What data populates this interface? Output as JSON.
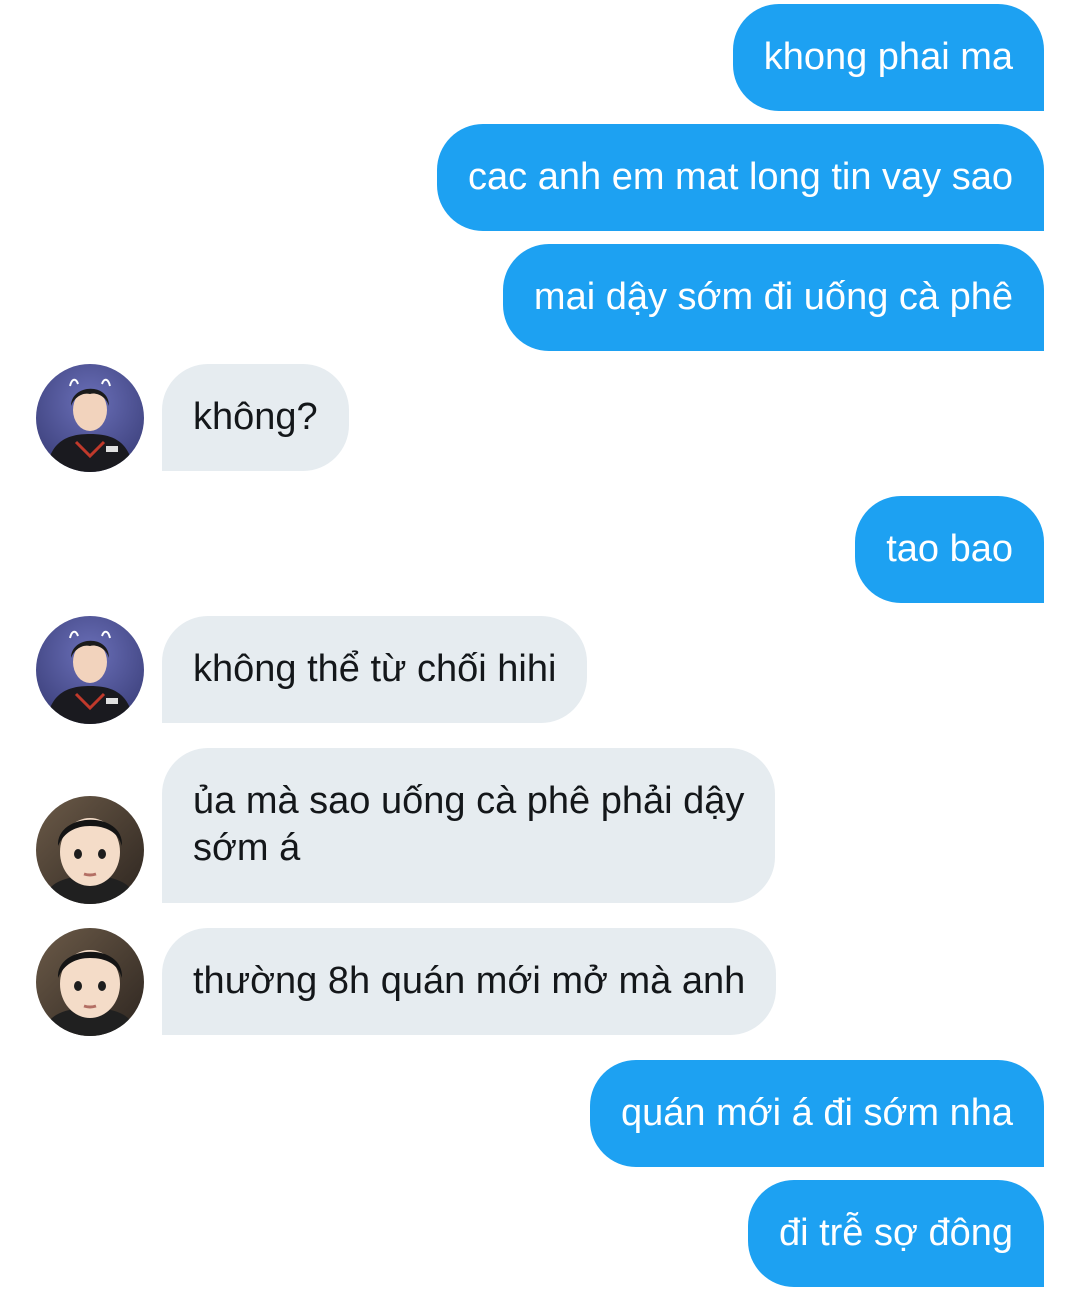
{
  "colors": {
    "outgoing_bubble": "#1da1f2",
    "incoming_bubble": "#e6ecf0",
    "outgoing_text": "#ffffff",
    "incoming_text": "#14171a"
  },
  "messages": [
    {
      "direction": "outgoing",
      "text": "khong phai ma"
    },
    {
      "direction": "outgoing",
      "text": "cac anh em mat long tin vay sao"
    },
    {
      "direction": "outgoing",
      "text": "mai dậy sớm đi uống cà phê"
    },
    {
      "direction": "incoming",
      "sender_avatar": "avatar-a",
      "text": "không?"
    },
    {
      "direction": "outgoing",
      "text": "tao bao"
    },
    {
      "direction": "incoming",
      "sender_avatar": "avatar-a",
      "text": "không thể từ chối hihi"
    },
    {
      "direction": "incoming",
      "sender_avatar": "avatar-b",
      "text": "ủa mà sao uống cà phê phải dậy\nsớm á"
    },
    {
      "direction": "incoming",
      "sender_avatar": "avatar-b",
      "text": "thường 8h quán mới mở mà anh"
    },
    {
      "direction": "outgoing",
      "text": "quán mới á đi sớm nha"
    },
    {
      "direction": "outgoing",
      "text": "đi trễ sợ đông"
    }
  ]
}
